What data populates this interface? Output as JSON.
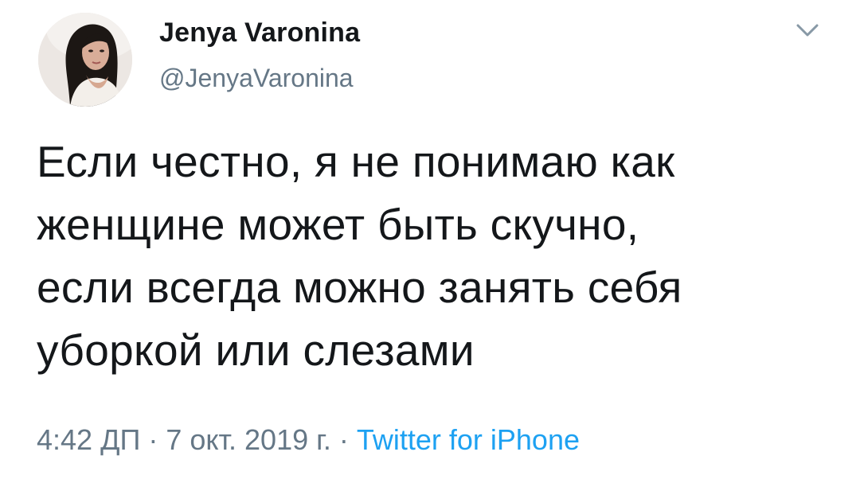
{
  "author": {
    "name": "Jenya Varonina",
    "handle": "@JenyaVaronina"
  },
  "menu_icon": "chevron-down-icon",
  "tweet": {
    "lines": [
      "Если честно, я не понимаю как",
      "женщине может быть скучно,",
      "если всегда можно занять себя",
      "уборкой или слезами"
    ]
  },
  "meta": {
    "time": "4:42 ДП",
    "separator1": " · ",
    "date": "7 окт. 2019 г.",
    "separator2": " · ",
    "source": "Twitter for iPhone"
  },
  "colors": {
    "text": "#14171a",
    "secondary": "#657786",
    "link": "#1da1f2",
    "chevron": "#8899a6"
  }
}
